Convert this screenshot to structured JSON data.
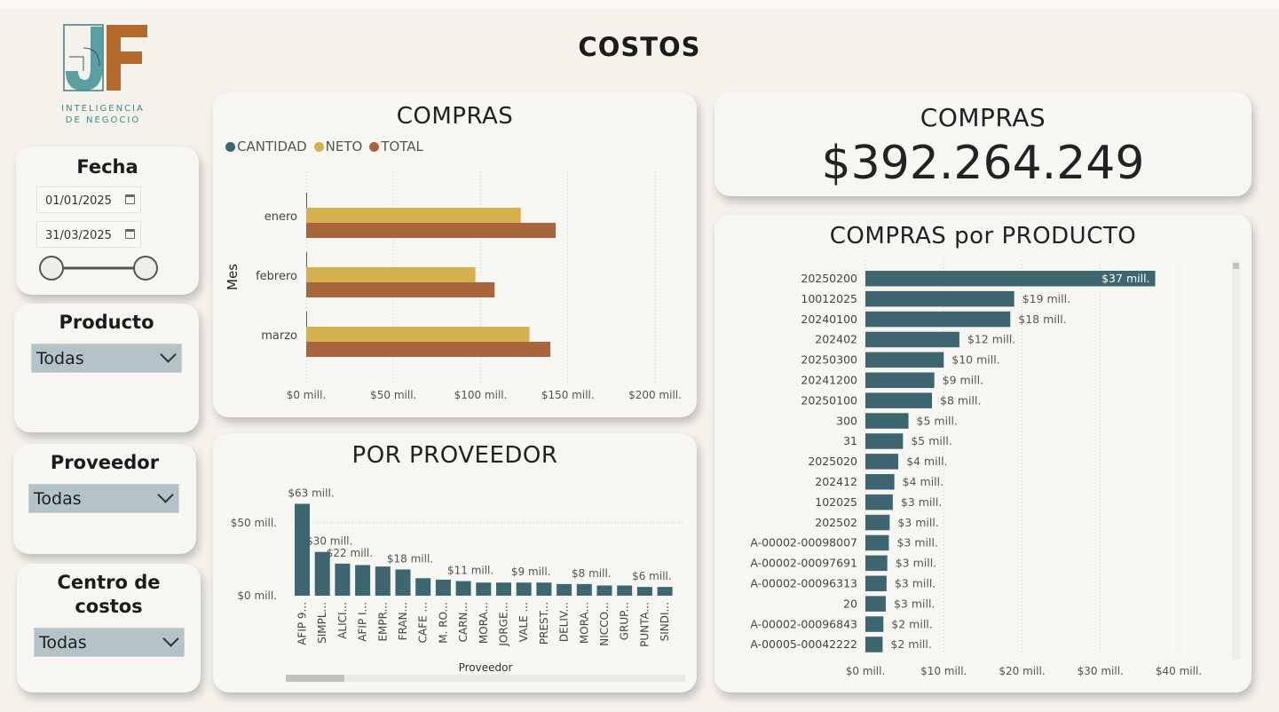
{
  "page": {
    "title": "COSTOS"
  },
  "logo": {
    "letters": "JF",
    "subtitle_line1": "INTELIGENCIA",
    "subtitle_line2": "DE NEGOCIO"
  },
  "filters": {
    "fecha": {
      "label": "Fecha",
      "start": "01/01/2025",
      "end": "31/03/2025",
      "slider_range": [
        0,
        1
      ]
    },
    "producto": {
      "label": "Producto",
      "value": "Todas"
    },
    "proveedor": {
      "label": "Proveedor",
      "value": "Todas"
    },
    "centro": {
      "label": "Centro de costos",
      "value": "Todas"
    }
  },
  "kpi": {
    "label": "COMPRAS",
    "value": "$392.264.249"
  },
  "colors": {
    "cantidad": "#3e6670",
    "neto": "#d4b04e",
    "total": "#a8643a",
    "bar": "#3e6670"
  },
  "chart_data": [
    {
      "type": "bar",
      "orientation": "horizontal",
      "title": "COMPRAS",
      "ylabel": "Mes",
      "categories": [
        "enero",
        "febrero",
        "marzo"
      ],
      "series": [
        {
          "name": "CANTIDAD",
          "values": [
            0.3,
            0.3,
            0.3
          ]
        },
        {
          "name": "NETO",
          "values": [
            123,
            97,
            128
          ]
        },
        {
          "name": "TOTAL",
          "values": [
            143,
            108,
            140
          ]
        }
      ],
      "xlim": [
        0,
        200
      ],
      "xticks": [
        "$0 mill.",
        "$50 mill.",
        "$100 mill.",
        "$150 mill.",
        "$200 mill."
      ],
      "legend": "top-left",
      "grid": true
    },
    {
      "type": "bar",
      "title": "POR PROVEEDOR",
      "xlabel": "Proveedor",
      "categories": [
        "AFIP 9...",
        "SIMPL...",
        "ALICI...",
        "AFIP I...",
        "EMPR...",
        "FRAN...",
        "CAFE ...",
        "M. RO...",
        "CARN...",
        "MORA...",
        "JORGE...",
        "VALE ...",
        "PREST...",
        "DELIV...",
        "MORA...",
        "NICCO...",
        "GRUP...",
        "PUNTA...",
        "SINDI..."
      ],
      "values": [
        63,
        30,
        22,
        21,
        20,
        18,
        12,
        11,
        10,
        9,
        9,
        9,
        9,
        8,
        8,
        7,
        7,
        6,
        6
      ],
      "data_labels": [
        {
          "index": 0,
          "text": "$63 mill."
        },
        {
          "index": 1,
          "text": "$30 mill."
        },
        {
          "index": 2,
          "text": "$22 mill."
        },
        {
          "index": 5,
          "text": "$18 mill."
        },
        {
          "index": 8,
          "text": "$11 mill."
        },
        {
          "index": 11,
          "text": "$9 mill."
        },
        {
          "index": 14,
          "text": "$8 mill."
        },
        {
          "index": 17,
          "text": "$6 mill."
        }
      ],
      "ylim": [
        0,
        70
      ],
      "yticks": [
        {
          "value": 0,
          "label": "$0 mill."
        },
        {
          "value": 50,
          "label": "$50 mill."
        }
      ],
      "grid": true
    },
    {
      "type": "bar",
      "orientation": "horizontal",
      "title": "COMPRAS por PRODUCTO",
      "categories": [
        "20250200",
        "10012025",
        "20240100",
        "202402",
        "20250300",
        "20241200",
        "20250100",
        "300",
        "31",
        "2025020",
        "202412",
        "102025",
        "202502",
        "A-00002-00098007",
        "A-00002-00097691",
        "A-00002-00096313",
        "20",
        "A-00002-00096843",
        "A-00005-00042222"
      ],
      "values": [
        37,
        19,
        18.5,
        12,
        10,
        8.8,
        8.5,
        5.5,
        4.8,
        4.2,
        3.7,
        3.5,
        3.1,
        3.0,
        2.8,
        2.7,
        2.6,
        2.3,
        2.2
      ],
      "labels": [
        "$37 mill.",
        "$19 mill.",
        "$18 mill.",
        "$12 mill.",
        "$10 mill.",
        "$9 mill.",
        "$8 mill.",
        "$5 mill.",
        "$5 mill.",
        "$4 mill.",
        "$4 mill.",
        "$3 mill.",
        "$3 mill.",
        "$3 mill.",
        "$3 mill.",
        "$3 mill.",
        "$3 mill.",
        "$2 mill.",
        "$2 mill."
      ],
      "xlim": [
        0,
        40
      ],
      "xticks": [
        "$0 mill.",
        "$10 mill.",
        "$20 mill.",
        "$30 mill.",
        "$40 mill."
      ],
      "grid": true
    }
  ]
}
